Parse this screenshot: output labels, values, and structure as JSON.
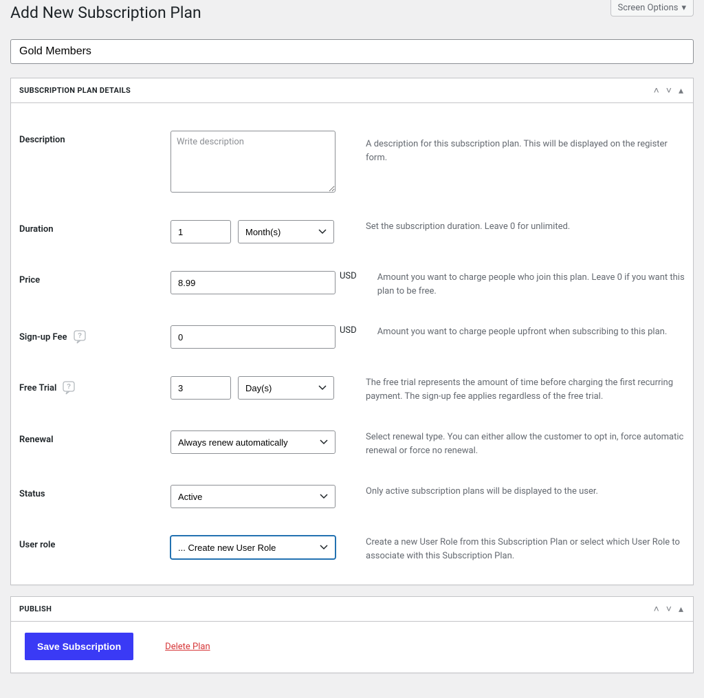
{
  "header": {
    "page_title": "Add New Subscription Plan",
    "screen_options_label": "Screen Options"
  },
  "title_input_value": "Gold Members",
  "panels": {
    "details": {
      "title": "SUBSCRIPTION PLAN DETAILS"
    },
    "publish": {
      "title": "PUBLISH",
      "save_label": "Save Subscription",
      "delete_label": "Delete Plan"
    }
  },
  "fields": {
    "description": {
      "label": "Description",
      "placeholder": "Write description",
      "value": "",
      "help": "A description for this subscription plan. This will be displayed on the register form."
    },
    "duration": {
      "label": "Duration",
      "value": "1",
      "unit_selected": "Month(s)",
      "help": "Set the subscription duration. Leave 0 for unlimited."
    },
    "price": {
      "label": "Price",
      "value": "8.99",
      "currency": "USD",
      "help": "Amount you want to charge people who join this plan. Leave 0 if you want this plan to be free."
    },
    "signup_fee": {
      "label": "Sign-up Fee",
      "value": "0",
      "currency": "USD",
      "help": "Amount you want to charge people upfront when subscribing to this plan."
    },
    "free_trial": {
      "label": "Free Trial",
      "value": "3",
      "unit_selected": "Day(s)",
      "help": "The free trial represents the amount of time before charging the first recurring payment. The sign-up fee applies regardless of the free trial."
    },
    "renewal": {
      "label": "Renewal",
      "selected": "Always renew automatically",
      "help": "Select renewal type. You can either allow the customer to opt in, force automatic renewal or force no renewal."
    },
    "status": {
      "label": "Status",
      "selected": "Active",
      "help": "Only active subscription plans will be displayed to the user."
    },
    "user_role": {
      "label": "User role",
      "selected": "... Create new User Role",
      "help": "Create a new User Role from this Subscription Plan or select which User Role to associate with this Subscription Plan."
    }
  }
}
